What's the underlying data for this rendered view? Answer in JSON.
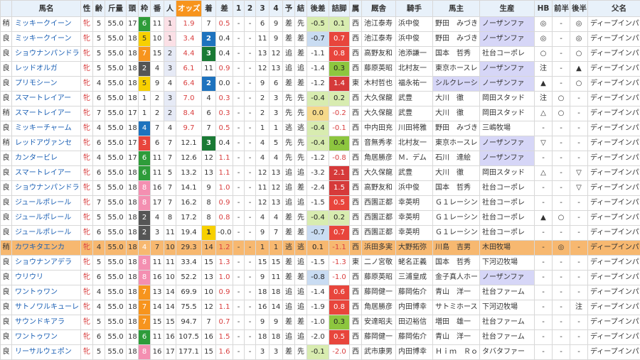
{
  "headers": {
    "cond": "",
    "name": "馬名",
    "sex": "性",
    "age": "齢",
    "weight": "斤量",
    "field": "頭",
    "frame": "枠",
    "num": "番",
    "pop": "人",
    "odds": "オッズ",
    "finish": "着",
    "diff": "差",
    "c1": "1",
    "c2": "2",
    "c3": "3",
    "c4": "4",
    "pred": "予",
    "result": "結",
    "late": "後差",
    "stretch": "詰脚",
    "belong": "属",
    "stable": "厩舎",
    "jockey": "騎手",
    "owner": "馬主",
    "breeder": "生産",
    "hb": "HB",
    "front": "前半",
    "back": "後半",
    "sire": "父名"
  },
  "rows": [
    {
      "cond": "稍",
      "name": "ミッキークイーン",
      "sex": "牝",
      "age": "5",
      "weight": "55.0",
      "field": "17",
      "frame": "6",
      "num": "11",
      "pop": "1",
      "odds": "1.9",
      "finish": "7",
      "diff": "0.5",
      "c1": "-",
      "c2": "-",
      "c3": "6",
      "c4": "9",
      "pred": "差",
      "result": "先",
      "late": "-0.5",
      "stretch": "0.1",
      "belong": "西",
      "stable": "池江泰寿",
      "jockey": "浜中俊",
      "owner": "野田　みづき",
      "breeder": "ノーザンファ",
      "hb": "◎",
      "front": "-",
      "back": "◎",
      "sire": "ディープインパクト"
    },
    {
      "cond": "良",
      "name": "ミッキークイーン",
      "sex": "牝",
      "age": "5",
      "weight": "55.0",
      "field": "18",
      "frame": "5",
      "num": "10",
      "pop": "1",
      "odds": "3.4",
      "finish": "2",
      "diff": "0.4",
      "c1": "-",
      "c2": "-",
      "c3": "11",
      "c4": "9",
      "pred": "差",
      "result": "差",
      "late": "-0.7",
      "stretch": "0.7",
      "belong": "西",
      "stable": "池江泰寿",
      "jockey": "浜中俊",
      "owner": "野田　みづき",
      "breeder": "ノーザンファ",
      "hb": "◎",
      "front": "-",
      "back": "◎",
      "sire": "ディープインパクト"
    },
    {
      "cond": "良",
      "name": "ショウナンパンドラ",
      "sex": "牝",
      "age": "5",
      "weight": "55.0",
      "field": "18",
      "frame": "7",
      "num": "15",
      "pop": "2",
      "odds": "4.4",
      "finish": "3",
      "diff": "0.4",
      "c1": "-",
      "c2": "-",
      "c3": "13",
      "c4": "12",
      "pred": "追",
      "result": "差",
      "late": "-1.1",
      "stretch": "0.8",
      "belong": "西",
      "stable": "高野友和",
      "jockey": "池添謙一",
      "owner": "国本　哲秀",
      "breeder": "社台コーポレ",
      "hb": "○",
      "front": "-",
      "back": "○",
      "sire": "ディープインパクト"
    },
    {
      "cond": "良",
      "name": "レッドオルガ",
      "sex": "牝",
      "age": "5",
      "weight": "55.0",
      "field": "18",
      "frame": "2",
      "num": "4",
      "pop": "3",
      "odds": "6.1",
      "finish": "11",
      "diff": "0.9",
      "c1": "-",
      "c2": "-",
      "c3": "12",
      "c4": "13",
      "pred": "追",
      "result": "追",
      "late": "-1.4",
      "stretch": "0.3",
      "belong": "西",
      "stable": "藤原英昭",
      "jockey": "北村友一",
      "owner": "東京ホースレ",
      "breeder": "ノーザンファ",
      "hb": "注",
      "front": "-",
      "back": "▲",
      "sire": "ディープインパクト"
    },
    {
      "cond": "良",
      "name": "プリモシーン",
      "sex": "牝",
      "age": "4",
      "weight": "55.0",
      "field": "18",
      "frame": "5",
      "num": "9",
      "pop": "4",
      "odds": "6.4",
      "finish": "2",
      "diff": "0.0",
      "c1": "-",
      "c2": "-",
      "c3": "9",
      "c4": "6",
      "pred": "差",
      "result": "差",
      "late": "-1.2",
      "stretch": "1.4",
      "belong": "東",
      "stable": "木村哲也",
      "jockey": "福永祐一",
      "owner": "シルクレーシ",
      "breeder": "ノーザンファ",
      "hb": "▲",
      "front": "-",
      "back": "○",
      "sire": "ディープインパクト"
    },
    {
      "cond": "良",
      "name": "スマートレイアー",
      "sex": "牝",
      "age": "6",
      "weight": "55.0",
      "field": "18",
      "frame": "1",
      "num": "2",
      "pop": "3",
      "odds": "7.0",
      "finish": "4",
      "diff": "0.3",
      "c1": "-",
      "c2": "-",
      "c3": "2",
      "c4": "3",
      "pred": "先",
      "result": "先",
      "late": "-0.4",
      "stretch": "0.2",
      "belong": "西",
      "stable": "大久保龍",
      "jockey": "武豊",
      "owner": "大川　徹",
      "breeder": "岡田スタッド",
      "hb": "注",
      "front": "○",
      "back": "-",
      "sire": "ディープインパクト"
    },
    {
      "cond": "稍",
      "name": "スマートレイアー",
      "sex": "牝",
      "age": "7",
      "weight": "55.0",
      "field": "17",
      "frame": "1",
      "num": "2",
      "pop": "2",
      "odds": "8.4",
      "finish": "6",
      "diff": "0.3",
      "c1": "-",
      "c2": "-",
      "c3": "2",
      "c4": "3",
      "pred": "先",
      "result": "先",
      "late": "0.0",
      "stretch": "-0.2",
      "belong": "西",
      "stable": "大久保龍",
      "jockey": "武豊",
      "owner": "大川　徹",
      "breeder": "岡田スタッド",
      "hb": "△",
      "front": "○",
      "back": "-",
      "sire": "ディープインパクト"
    },
    {
      "cond": "良",
      "name": "ミッキーチャーム",
      "sex": "牝",
      "age": "4",
      "weight": "55.0",
      "field": "18",
      "frame": "4",
      "num": "7",
      "pop": "4",
      "odds": "9.7",
      "finish": "7",
      "diff": "0.5",
      "c1": "-",
      "c2": "-",
      "c3": "1",
      "c4": "1",
      "pred": "逃",
      "result": "逃",
      "late": "-0.4",
      "stretch": "-0.1",
      "belong": "西",
      "stable": "中内田充",
      "jockey": "川田将雅",
      "owner": "野田　みづき",
      "breeder": "三嶋牧場",
      "hb": "-",
      "front": "-",
      "back": "-",
      "sire": "ディープインパクト"
    },
    {
      "cond": "稍",
      "name": "レッドアヴァンセ",
      "sex": "牝",
      "age": "6",
      "weight": "55.0",
      "field": "17",
      "frame": "3",
      "num": "6",
      "pop": "7",
      "odds": "12.1",
      "finish": "3",
      "diff": "0.4",
      "c1": "-",
      "c2": "-",
      "c3": "4",
      "c4": "5",
      "pred": "先",
      "result": "先",
      "late": "-0.4",
      "stretch": "0.4",
      "belong": "西",
      "stable": "音無秀孝",
      "jockey": "北村友一",
      "owner": "東京ホースレ",
      "breeder": "ノーザンファ",
      "hb": "▽",
      "front": "-",
      "back": "-",
      "sire": "ディープインパクト"
    },
    {
      "cond": "良",
      "name": "カンタービレ",
      "sex": "牝",
      "age": "4",
      "weight": "55.0",
      "field": "17",
      "frame": "6",
      "num": "11",
      "pop": "7",
      "odds": "12.6",
      "finish": "12",
      "diff": "1.1",
      "c1": "-",
      "c2": "-",
      "c3": "4",
      "c4": "4",
      "pred": "先",
      "result": "先",
      "late": "-1.2",
      "stretch": "-0.8",
      "belong": "西",
      "stable": "角居勝彦",
      "jockey": "Ｍ．デム",
      "owner": "石川　達絵",
      "breeder": "ノーザンファ",
      "hb": "-",
      "front": "-",
      "back": "-",
      "sire": "ディープインパクト"
    },
    {
      "cond": "良",
      "name": "スマートレイアー",
      "sex": "牝",
      "age": "6",
      "weight": "55.0",
      "field": "18",
      "frame": "6",
      "num": "11",
      "pop": "5",
      "odds": "13.2",
      "finish": "13",
      "diff": "1.1",
      "c1": "-",
      "c2": "-",
      "c3": "12",
      "c4": "13",
      "pred": "追",
      "result": "追",
      "late": "-3.2",
      "stretch": "2.1",
      "belong": "西",
      "stable": "大久保龍",
      "jockey": "武豊",
      "owner": "大川　徹",
      "breeder": "岡田スタッド",
      "hb": "△",
      "front": "-",
      "back": "▽",
      "sire": "ディープインパクト"
    },
    {
      "cond": "良",
      "name": "ショウナンパンドラ",
      "sex": "牝",
      "age": "5",
      "weight": "55.0",
      "field": "18",
      "frame": "8",
      "num": "16",
      "pop": "7",
      "odds": "14.1",
      "finish": "9",
      "diff": "1.0",
      "c1": "-",
      "c2": "-",
      "c3": "11",
      "c4": "12",
      "pred": "追",
      "result": "差",
      "late": "-2.4",
      "stretch": "1.5",
      "belong": "西",
      "stable": "高野友和",
      "jockey": "浜中俊",
      "owner": "国本　哲秀",
      "breeder": "社台コーポレ",
      "hb": "-",
      "front": "-",
      "back": "▽",
      "sire": "ディープインパクト"
    },
    {
      "cond": "良",
      "name": "ジュールポレール",
      "sex": "牝",
      "age": "7",
      "weight": "55.0",
      "field": "18",
      "frame": "8",
      "num": "17",
      "pop": "7",
      "odds": "16.2",
      "finish": "8",
      "diff": "0.9",
      "c1": "-",
      "c2": "-",
      "c3": "12",
      "c4": "13",
      "pred": "追",
      "result": "追",
      "late": "-1.5",
      "stretch": "0.5",
      "belong": "西",
      "stable": "西園正都",
      "jockey": "幸英明",
      "owner": "Ｇ１レーシン",
      "breeder": "社台コーポレ",
      "hb": "-",
      "front": "-",
      "back": "-",
      "sire": "ディープインパクト"
    },
    {
      "cond": "良",
      "name": "ジュールポレール",
      "sex": "牝",
      "age": "5",
      "weight": "55.0",
      "field": "18",
      "frame": "2",
      "num": "4",
      "pop": "8",
      "odds": "17.2",
      "finish": "8",
      "diff": "0.8",
      "c1": "-",
      "c2": "-",
      "c3": "4",
      "c4": "4",
      "pred": "差",
      "result": "先",
      "late": "-0.4",
      "stretch": "0.2",
      "belong": "西",
      "stable": "西園正都",
      "jockey": "幸英明",
      "owner": "Ｇ１レーシン",
      "breeder": "社台コーポレ",
      "hb": "▲",
      "front": "○",
      "back": "-",
      "sire": "ディープインパクト"
    },
    {
      "cond": "良",
      "name": "ジュールポレール",
      "sex": "牝",
      "age": "6",
      "weight": "55.0",
      "field": "18",
      "frame": "2",
      "num": "3",
      "pop": "11",
      "odds": "19.4",
      "finish": "1",
      "diff": "-0.0",
      "c1": "-",
      "c2": "-",
      "c3": "9",
      "c4": "7",
      "pred": "差",
      "result": "差",
      "late": "-0.7",
      "stretch": "0.7",
      "belong": "西",
      "stable": "西園正都",
      "jockey": "幸英明",
      "owner": "Ｇ１レーシン",
      "breeder": "社台コーポレ",
      "hb": "-",
      "front": "-",
      "back": "-",
      "sire": "ディープインパクト"
    },
    {
      "cond": "稍",
      "name": "カワキタエンカ",
      "sex": "牝",
      "age": "4",
      "weight": "55.0",
      "field": "18",
      "frame": "4",
      "num": "7",
      "pop": "10",
      "odds": "29.3",
      "finish": "14",
      "diff": "1.2",
      "c1": "-",
      "c2": "-",
      "c3": "1",
      "c4": "1",
      "pred": "逃",
      "result": "逃",
      "late": "0.1",
      "stretch": "-1.1",
      "belong": "西",
      "stable": "浜田多実",
      "jockey": "大野拓弥",
      "owner": "川島　吉男",
      "breeder": "木田牧場",
      "hb": "-",
      "front": "◎",
      "back": "-",
      "sire": "ディープインパクト"
    },
    {
      "cond": "良",
      "name": "ショウナンアデラ",
      "sex": "牝",
      "age": "5",
      "weight": "55.0",
      "field": "18",
      "frame": "8",
      "num": "11",
      "pop": "11",
      "odds": "33.4",
      "finish": "15",
      "diff": "1.3",
      "c1": "-",
      "c2": "-",
      "c3": "15",
      "c4": "15",
      "pred": "差",
      "result": "追",
      "late": "-1.5",
      "stretch": "-1.3",
      "belong": "東",
      "stable": "二ノ宮敬",
      "jockey": "蛯名正義",
      "owner": "国本　哲秀",
      "breeder": "下河辺牧場",
      "hb": "-",
      "front": "-",
      "back": "-",
      "sire": "ディープインパクト"
    },
    {
      "cond": "良",
      "name": "ウリウリ",
      "sex": "牝",
      "age": "6",
      "weight": "55.0",
      "field": "18",
      "frame": "8",
      "num": "16",
      "pop": "10",
      "odds": "52.2",
      "finish": "13",
      "diff": "1.0",
      "c1": "-",
      "c2": "-",
      "c3": "9",
      "c4": "11",
      "pred": "差",
      "result": "差",
      "late": "-0.8",
      "stretch": "-1.0",
      "belong": "西",
      "stable": "藤原英昭",
      "jockey": "三浦皇成",
      "owner": "金子真人ホー",
      "breeder": "ノーザンファ",
      "hb": "-",
      "front": "-",
      "back": "-",
      "sire": "ディープインパクト"
    },
    {
      "cond": "良",
      "name": "ワントゥワン",
      "sex": "牝",
      "age": "4",
      "weight": "55.0",
      "field": "18",
      "frame": "7",
      "num": "13",
      "pop": "14",
      "odds": "69.9",
      "finish": "10",
      "diff": "0.9",
      "c1": "-",
      "c2": "-",
      "c3": "18",
      "c4": "18",
      "pred": "追",
      "result": "追",
      "late": "-1.4",
      "stretch": "0.6",
      "belong": "西",
      "stable": "藤岡健一",
      "jockey": "藤岡佑介",
      "owner": "青山　洋一",
      "breeder": "社台ファーム",
      "hb": "-",
      "front": "-",
      "back": "-",
      "sire": "ディープインパクト"
    },
    {
      "cond": "良",
      "name": "サトノワルキューレ",
      "sex": "牝",
      "age": "4",
      "weight": "55.0",
      "field": "18",
      "frame": "7",
      "num": "14",
      "pop": "14",
      "odds": "75.5",
      "finish": "12",
      "diff": "1.1",
      "c1": "-",
      "c2": "-",
      "c3": "16",
      "c4": "14",
      "pred": "追",
      "result": "追",
      "late": "-1.9",
      "stretch": "0.8",
      "belong": "西",
      "stable": "角居勝彦",
      "jockey": "内田博幸",
      "owner": "サトミホース",
      "breeder": "下河辺牧場",
      "hb": "-",
      "front": "-",
      "back": "注",
      "sire": "ディープインパクト"
    },
    {
      "cond": "良",
      "name": "サウンドキアラ",
      "sex": "牝",
      "age": "5",
      "weight": "55.0",
      "field": "18",
      "frame": "7",
      "num": "15",
      "pop": "15",
      "odds": "94.7",
      "finish": "7",
      "diff": "0.7",
      "c1": "-",
      "c2": "-",
      "c3": "9",
      "c4": "9",
      "pred": "差",
      "result": "差",
      "late": "-1.0",
      "stretch": "0.3",
      "belong": "西",
      "stable": "安達昭夫",
      "jockey": "田辺裕信",
      "owner": "増田　雄一",
      "breeder": "社台ファーム",
      "hb": "-",
      "front": "-",
      "back": "-",
      "sire": "ディープインパクト"
    },
    {
      "cond": "良",
      "name": "ワントゥワン",
      "sex": "牝",
      "age": "6",
      "weight": "55.0",
      "field": "18",
      "frame": "6",
      "num": "11",
      "pop": "16",
      "odds": "107.5",
      "finish": "16",
      "diff": "1.5",
      "c1": "-",
      "c2": "-",
      "c3": "18",
      "c4": "18",
      "pred": "追",
      "result": "追",
      "late": "-2.0",
      "stretch": "0.5",
      "belong": "西",
      "stable": "藤岡健一",
      "jockey": "藤岡佑介",
      "owner": "青山　洋一",
      "breeder": "社台ファーム",
      "hb": "-",
      "front": "-",
      "back": "-",
      "sire": "ディープインパクト"
    },
    {
      "cond": "良",
      "name": "リーサルウェポン",
      "sex": "牝",
      "age": "5",
      "weight": "55.0",
      "field": "18",
      "frame": "8",
      "num": "16",
      "pop": "17",
      "odds": "177.1",
      "finish": "15",
      "diff": "1.6",
      "c1": "-",
      "c2": "-",
      "c3": "3",
      "c4": "3",
      "pred": "差",
      "result": "先",
      "late": "-0.1",
      "stretch": "-2.0",
      "belong": "西",
      "stable": "武市康男",
      "jockey": "内田博幸",
      "owner": "Ｈｉｍ　Ｒｏ",
      "breeder": "タバタファー",
      "hb": "-",
      "front": "-",
      "back": "-",
      "sire": "ディープインパクト"
    }
  ]
}
